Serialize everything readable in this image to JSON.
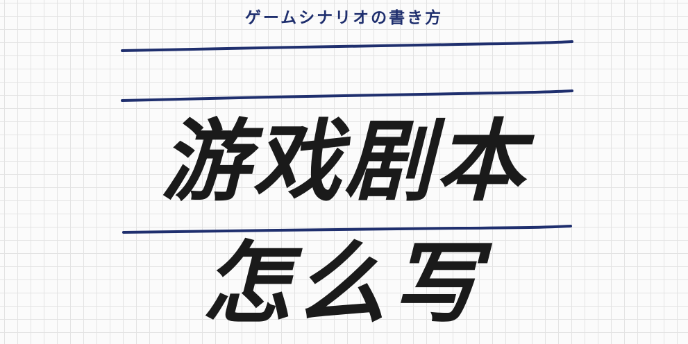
{
  "cover": {
    "subtitle": "ゲームシナリオの書き方",
    "title_line_1": "游戏剧本",
    "title_line_2": "怎么写",
    "colors": {
      "accent_blue": "#1f2f6e",
      "title_black": "#1a1a1a",
      "grid_line": "#e3e3e3",
      "background": "#fbfbfb"
    }
  }
}
